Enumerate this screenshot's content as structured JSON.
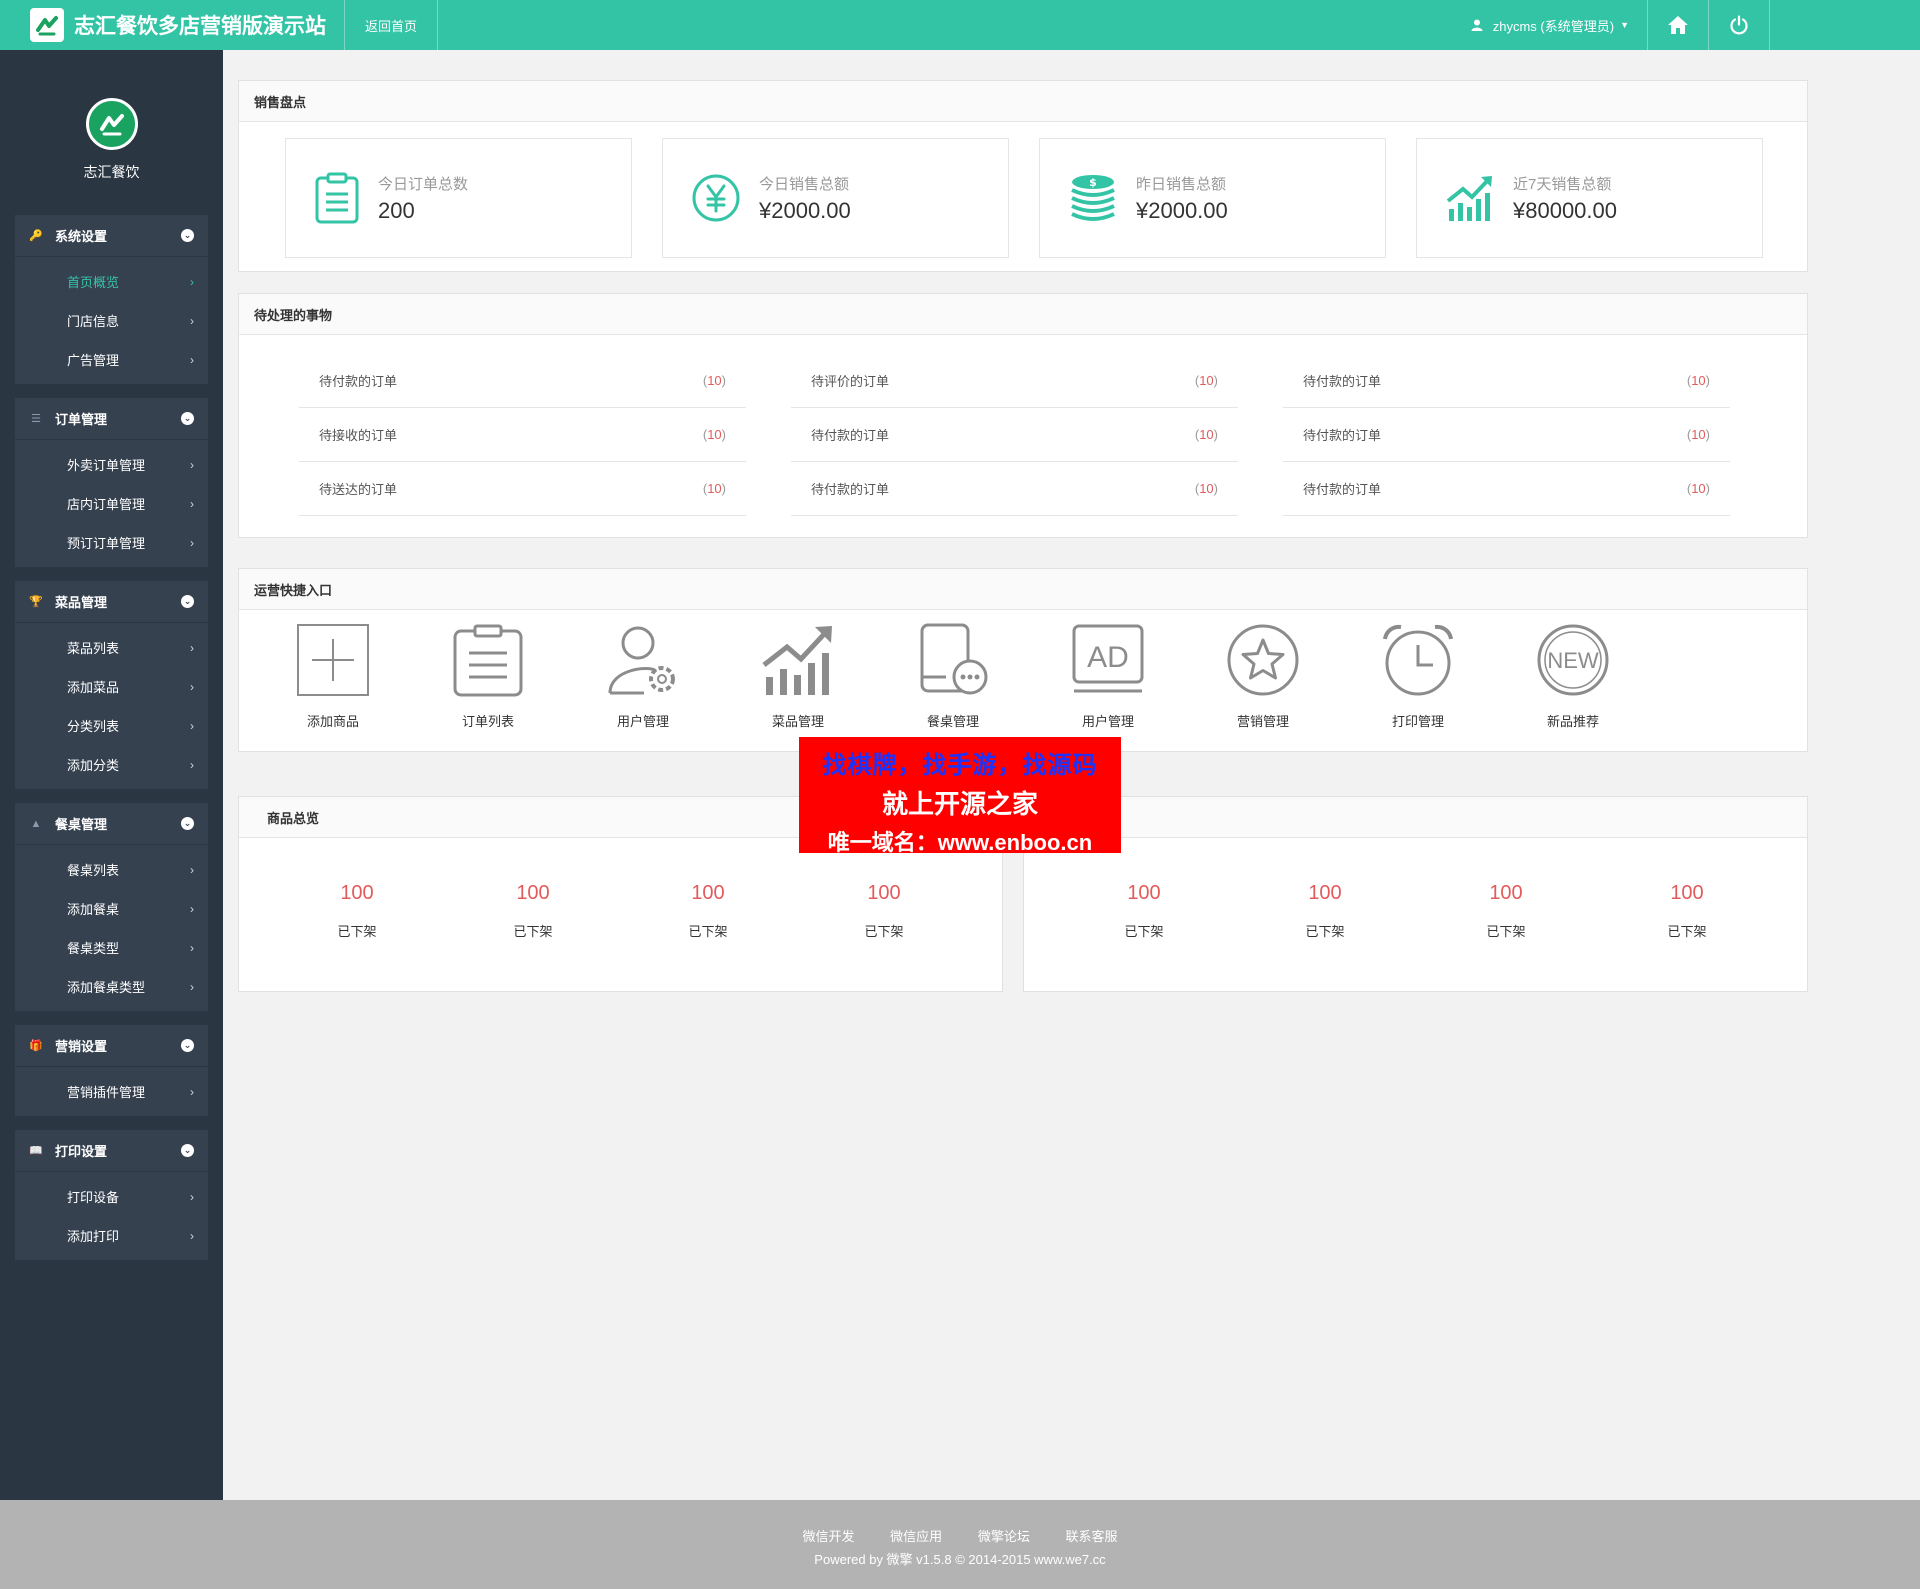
{
  "header": {
    "title": "志汇餐饮多店营销版演示站",
    "back_home": "返回首页",
    "user": "zhycms (系统管理员)"
  },
  "sidebar": {
    "brand": "志汇餐饮",
    "groups": [
      {
        "title": "系统设置",
        "items": [
          "首页概览",
          "门店信息",
          "广告管理"
        ]
      },
      {
        "title": "订单管理",
        "items": [
          "外卖订单管理",
          "店内订单管理",
          "预订订单管理"
        ]
      },
      {
        "title": "菜品管理",
        "items": [
          "菜品列表",
          "添加菜品",
          "分类列表",
          "添加分类"
        ]
      },
      {
        "title": "餐桌管理",
        "items": [
          "餐桌列表",
          "添加餐桌",
          "餐桌类型",
          "添加餐桌类型"
        ]
      },
      {
        "title": "营销设置",
        "items": [
          "营销插件管理"
        ]
      },
      {
        "title": "打印设置",
        "items": [
          "打印设备",
          "添加打印"
        ]
      }
    ]
  },
  "sales": {
    "title": "销售盘点",
    "cards": [
      {
        "label": "今日订单总数",
        "value": "200"
      },
      {
        "label": "今日销售总额",
        "value": "¥2000.00"
      },
      {
        "label": "昨日销售总额",
        "value": "¥2000.00"
      },
      {
        "label": "近7天销售总额",
        "value": "¥80000.00"
      }
    ]
  },
  "pending": {
    "title": "待处理的事物",
    "rows": [
      [
        {
          "label": "待付款的订单",
          "count": "10"
        },
        {
          "label": "待评价的订单",
          "count": "10"
        },
        {
          "label": "待付款的订单",
          "count": "10"
        }
      ],
      [
        {
          "label": "待接收的订单",
          "count": "10"
        },
        {
          "label": "待付款的订单",
          "count": "10"
        },
        {
          "label": "待付款的订单",
          "count": "10"
        }
      ],
      [
        {
          "label": "待送达的订单",
          "count": "10"
        },
        {
          "label": "待付款的订单",
          "count": "10"
        },
        {
          "label": "待付款的订单",
          "count": "10"
        }
      ]
    ]
  },
  "quick": {
    "title": "运营快捷入口",
    "items": [
      {
        "label": "添加商品",
        "icon": "plus-square-icon"
      },
      {
        "label": "订单列表",
        "icon": "clipboard-list-icon"
      },
      {
        "label": "用户管理",
        "icon": "user-gear-icon"
      },
      {
        "label": "菜品管理",
        "icon": "trend-chart-icon"
      },
      {
        "label": "餐桌管理",
        "icon": "tablet-chat-icon"
      },
      {
        "label": "用户管理",
        "icon": "ad-icon"
      },
      {
        "label": "营销管理",
        "icon": "star-circle-icon"
      },
      {
        "label": "打印管理",
        "icon": "alarm-clock-icon"
      },
      {
        "label": "新品推荐",
        "icon": "new-badge-icon"
      }
    ]
  },
  "goods": {
    "title": "商品总览",
    "left": [
      {
        "num": "100",
        "status": "已下架"
      },
      {
        "num": "100",
        "status": "已下架"
      },
      {
        "num": "100",
        "status": "已下架"
      },
      {
        "num": "100",
        "status": "已下架"
      }
    ],
    "right": [
      {
        "num": "100",
        "status": "已下架"
      },
      {
        "num": "100",
        "status": "已下架"
      },
      {
        "num": "100",
        "status": "已下架"
      },
      {
        "num": "100",
        "status": "已下架"
      }
    ]
  },
  "banner": {
    "line1": "找棋牌，找手游，找源码",
    "line2": "就上开源之家",
    "line3": "唯一域名：www.enboo.cn"
  },
  "footer": {
    "links": [
      "微信开发",
      "微信应用",
      "微擎论坛",
      "联系客服"
    ],
    "powered": "Powered by 微擎 v1.5.8 © 2014-2015 www.we7.cc"
  },
  "colors": {
    "accent": "#33c4a6",
    "sidebar": "#2b3643",
    "count": "#e25b5b"
  }
}
